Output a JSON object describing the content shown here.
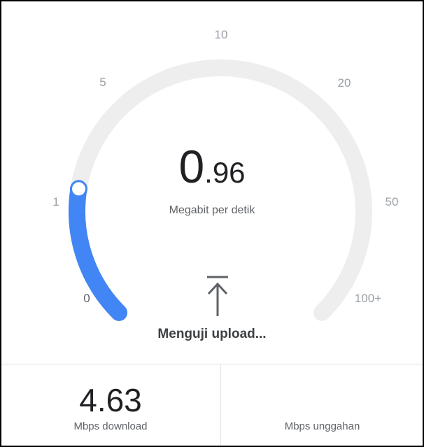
{
  "gauge": {
    "scale_labels": [
      "0",
      "1",
      "5",
      "10",
      "20",
      "50",
      "100+"
    ],
    "current_value_fraction": 0.2,
    "track_color": "#eeeeee",
    "progress_color": "#4285f4"
  },
  "speed": {
    "integer_part": "0",
    "decimal_part": ".96",
    "unit_label": "Megabit per detik"
  },
  "status": {
    "icon": "upload-arrow-icon",
    "text": "Menguji upload..."
  },
  "results": {
    "download": {
      "value": "4.63",
      "label": "Mbps download"
    },
    "upload": {
      "value": "",
      "label": "Mbps unggahan"
    }
  }
}
